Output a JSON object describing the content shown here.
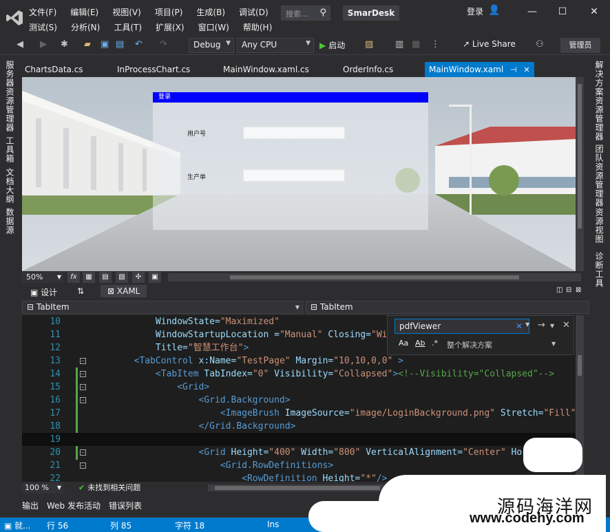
{
  "titlebar": {
    "menu_row1": [
      "文件(F)",
      "编辑(E)",
      "视图(V)",
      "项目(P)",
      "生成(B)",
      "调试(D)"
    ],
    "menu_row2": [
      "测试(S)",
      "分析(N)",
      "工具(T)",
      "扩展(X)",
      "窗口(W)",
      "帮助(H)"
    ],
    "search_placeholder": "搜索...",
    "app_name": "SmarDesk",
    "login": "登录"
  },
  "toolbar": {
    "config": "Debug",
    "platform": "Any CPU",
    "start": "启动",
    "live_share": "Live Share",
    "admin": "管理员"
  },
  "left_strip": [
    "服务器资源管理器",
    "工具箱",
    "文档大纲",
    "数据源"
  ],
  "right_strip": [
    "解决方案资源管理器",
    "团队资源管理器",
    "资源视图",
    "诊断工具"
  ],
  "doc_tabs": [
    "ChartsData.cs",
    "InProcessChart.cs",
    "MainWindow.xaml.cs",
    "OrderInfo.cs",
    "MainWindow.xaml"
  ],
  "designer": {
    "login_title": "登录",
    "user_label": "用户号",
    "order_label": "生产单",
    "zoom": "50%"
  },
  "split": {
    "design": "设计",
    "xaml": "XAML"
  },
  "nav": {
    "left": "TabItem",
    "right": "TabItem"
  },
  "code": {
    "lines": [
      {
        "n": "10",
        "fold": "",
        "parts": [
          [
            "t-at",
            "            WindowState="
          ],
          [
            "t-val",
            "\"Maximized\""
          ]
        ]
      },
      {
        "n": "11",
        "fold": "",
        "parts": [
          [
            "t-at",
            "            WindowStartupLocation ="
          ],
          [
            "t-val",
            "\"Manual\""
          ],
          [
            "t-at",
            " Closing="
          ],
          [
            "t-val",
            "\"Wind"
          ]
        ]
      },
      {
        "n": "12",
        "fold": "",
        "parts": [
          [
            "t-at",
            "            Title="
          ],
          [
            "t-val",
            "\"智慧工作台\""
          ],
          [
            "t-el",
            ">"
          ]
        ]
      },
      {
        "n": "13",
        "fold": "−",
        "parts": [
          [
            "t-el",
            "        <TabControl"
          ],
          [
            "t-at",
            " x:Name="
          ],
          [
            "t-val",
            "\"TestPage\""
          ],
          [
            "t-at",
            " Margin="
          ],
          [
            "t-val",
            "\"10,10,0,0\""
          ],
          [
            "t-el",
            " >"
          ]
        ]
      },
      {
        "n": "14",
        "fold": "−",
        "parts": [
          [
            "t-el",
            "            <TabItem"
          ],
          [
            "t-at",
            " TabIndex="
          ],
          [
            "t-val",
            "\"0\""
          ],
          [
            "t-at",
            " Visibility="
          ],
          [
            "t-val",
            "\"Collapsed\""
          ],
          [
            "t-el",
            ">"
          ],
          [
            "t-cm",
            "<!--Visibility=\"Collapsed\"-->"
          ]
        ]
      },
      {
        "n": "15",
        "fold": "−",
        "parts": [
          [
            "t-el",
            "                <Grid>"
          ]
        ]
      },
      {
        "n": "16",
        "fold": "−",
        "parts": [
          [
            "t-el",
            "                    <Grid.Background>"
          ]
        ]
      },
      {
        "n": "17",
        "fold": "",
        "parts": [
          [
            "t-el",
            "                        <ImageBrush"
          ],
          [
            "t-at",
            " ImageSource="
          ],
          [
            "t-val",
            "\"image/LoginBackground.png\""
          ],
          [
            "t-at",
            " Stretch="
          ],
          [
            "t-val",
            "\"Fill\""
          ],
          [
            "t-at",
            " O"
          ]
        ]
      },
      {
        "n": "18",
        "fold": "",
        "parts": [
          [
            "t-el",
            "                    </Grid.Background>"
          ]
        ]
      },
      {
        "n": "19",
        "fold": "",
        "parts": [
          [
            "t-pl",
            ""
          ]
        ]
      },
      {
        "n": "20",
        "fold": "−",
        "parts": [
          [
            "t-el",
            "                    <Grid"
          ],
          [
            "t-at",
            " Height="
          ],
          [
            "t-val",
            "\"400\""
          ],
          [
            "t-at",
            " Width="
          ],
          [
            "t-val",
            "\"800\""
          ],
          [
            "t-at",
            " VerticalAlignment="
          ],
          [
            "t-val",
            "\"Center\""
          ],
          [
            "t-at",
            " Horiz"
          ]
        ]
      },
      {
        "n": "21",
        "fold": "−",
        "parts": [
          [
            "t-el",
            "                        <Grid.RowDefinitions>"
          ]
        ]
      },
      {
        "n": "22",
        "fold": "",
        "parts": [
          [
            "t-el",
            "                            <RowDefinition"
          ],
          [
            "t-at",
            " Height="
          ],
          [
            "t-val",
            "\"*\""
          ],
          [
            "t-el",
            "/>"
          ]
        ]
      }
    ]
  },
  "find": {
    "query": "pdfViewer",
    "opt_case": "Aa",
    "opt_word": "Ab",
    "opt_regex": ".*",
    "scope": "整个解决方案"
  },
  "editor_status": {
    "zoom": "100 %",
    "issues": "未找到相关问题"
  },
  "output_tabs": [
    "输出",
    "Web 发布活动",
    "错误列表"
  ],
  "statusbar": {
    "ready": "就...",
    "line": "行 56",
    "col": "列 85",
    "char": "字符 18",
    "mode": "Ins"
  },
  "watermark": {
    "line1": "源码海洋网",
    "line2": "www.codehy.com"
  },
  "colors": {
    "accent": "#007acc",
    "login_header": "#0000ff",
    "bg": "#2d2d30",
    "editor_bg": "#1e1e1e"
  }
}
